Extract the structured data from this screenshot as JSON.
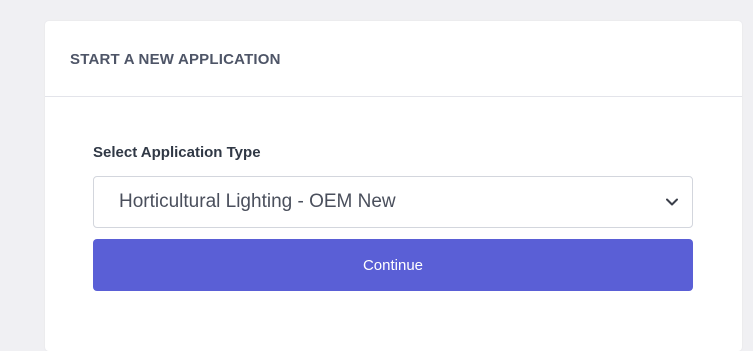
{
  "card": {
    "title": "START A NEW APPLICATION"
  },
  "form": {
    "label": "Select Application Type",
    "select": {
      "selected_value": "Horticultural Lighting - OEM New",
      "icon": "chevron-down-icon"
    },
    "continue_label": "Continue"
  },
  "colors": {
    "page_background": "#f0f0f3",
    "card_background": "#ffffff",
    "title_text": "#4e5567",
    "label_text": "#303845",
    "button_background": "#5a5fd6",
    "button_text": "#ffffff"
  }
}
